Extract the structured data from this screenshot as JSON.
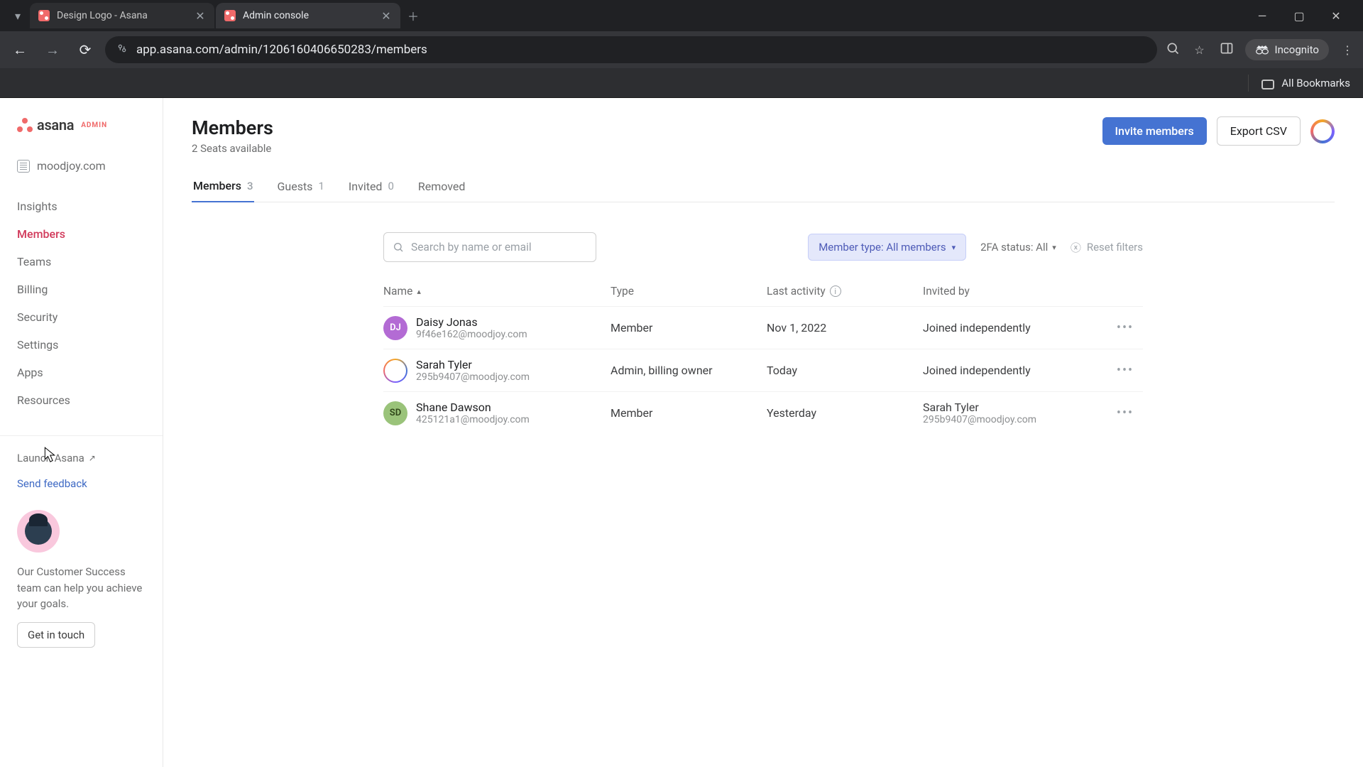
{
  "browser": {
    "tabs": [
      {
        "title": "Design Logo - Asana",
        "active": false
      },
      {
        "title": "Admin console",
        "active": true
      }
    ],
    "url": "app.asana.com/admin/1206160406650283/members",
    "incognito_label": "Incognito",
    "all_bookmarks": "All Bookmarks"
  },
  "sidebar": {
    "brand_word": "asana",
    "brand_admin": "ADMIN",
    "org_name": "moodjoy.com",
    "nav": {
      "insights": "Insights",
      "members": "Members",
      "teams": "Teams",
      "billing": "Billing",
      "security": "Security",
      "settings": "Settings",
      "apps": "Apps",
      "resources": "Resources"
    },
    "launch": "Launch Asana",
    "feedback": "Send feedback",
    "cs_text": "Our Customer Success team can help you achieve your goals.",
    "cs_button": "Get in touch"
  },
  "header": {
    "title": "Members",
    "seats": "2 Seats available",
    "invite": "Invite members",
    "export": "Export CSV"
  },
  "tabs": {
    "members": {
      "label": "Members",
      "count": "3"
    },
    "guests": {
      "label": "Guests",
      "count": "1"
    },
    "invited": {
      "label": "Invited",
      "count": "0"
    },
    "removed": {
      "label": "Removed"
    }
  },
  "filters": {
    "search_placeholder": "Search by name or email",
    "member_type": "Member type: All members",
    "twofa": "2FA status: All",
    "reset": "Reset filters"
  },
  "columns": {
    "name": "Name",
    "type": "Type",
    "last_activity": "Last activity",
    "invited_by": "Invited by"
  },
  "rows": [
    {
      "initials": "DJ",
      "avatar_class": "purple",
      "name": "Daisy Jonas",
      "email": "9f46e162@moodjoy.com",
      "type": "Member",
      "last_activity": "Nov 1, 2022",
      "invited_by": "Joined independently",
      "invited_by_sub": ""
    },
    {
      "initials": "",
      "avatar_class": "ring",
      "name": "Sarah Tyler",
      "email": "295b9407@moodjoy.com",
      "type": "Admin, billing owner",
      "last_activity": "Today",
      "invited_by": "Joined independently",
      "invited_by_sub": ""
    },
    {
      "initials": "SD",
      "avatar_class": "green",
      "name": "Shane Dawson",
      "email": "425121a1@moodjoy.com",
      "type": "Member",
      "last_activity": "Yesterday",
      "invited_by": "Sarah Tyler",
      "invited_by_sub": "295b9407@moodjoy.com"
    }
  ]
}
